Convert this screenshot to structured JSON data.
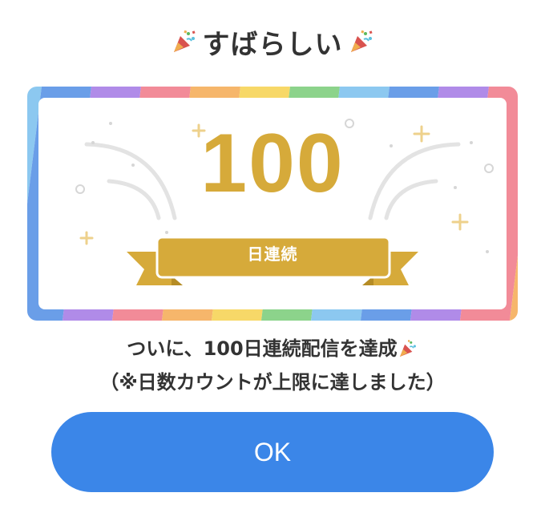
{
  "dialog": {
    "title": "すばらしい",
    "badge": {
      "count": "100",
      "label": "日連続"
    },
    "message_line1": "ついに、100日連続配信を達成",
    "message_line2": "（※日数カウントが上限に達しました）",
    "ok_label": "OK"
  },
  "colors": {
    "gold": "#d6aa3a",
    "button": "#3b86e8",
    "text": "#333333",
    "rainbow": [
      "#f28b98",
      "#f6b66b",
      "#f7d868",
      "#8cd38b",
      "#8cc8f0",
      "#6a9ee8",
      "#b08be8"
    ]
  },
  "icons": {
    "title_left": "party-popper-icon",
    "title_right": "party-popper-icon",
    "message_end": "party-popper-icon"
  }
}
